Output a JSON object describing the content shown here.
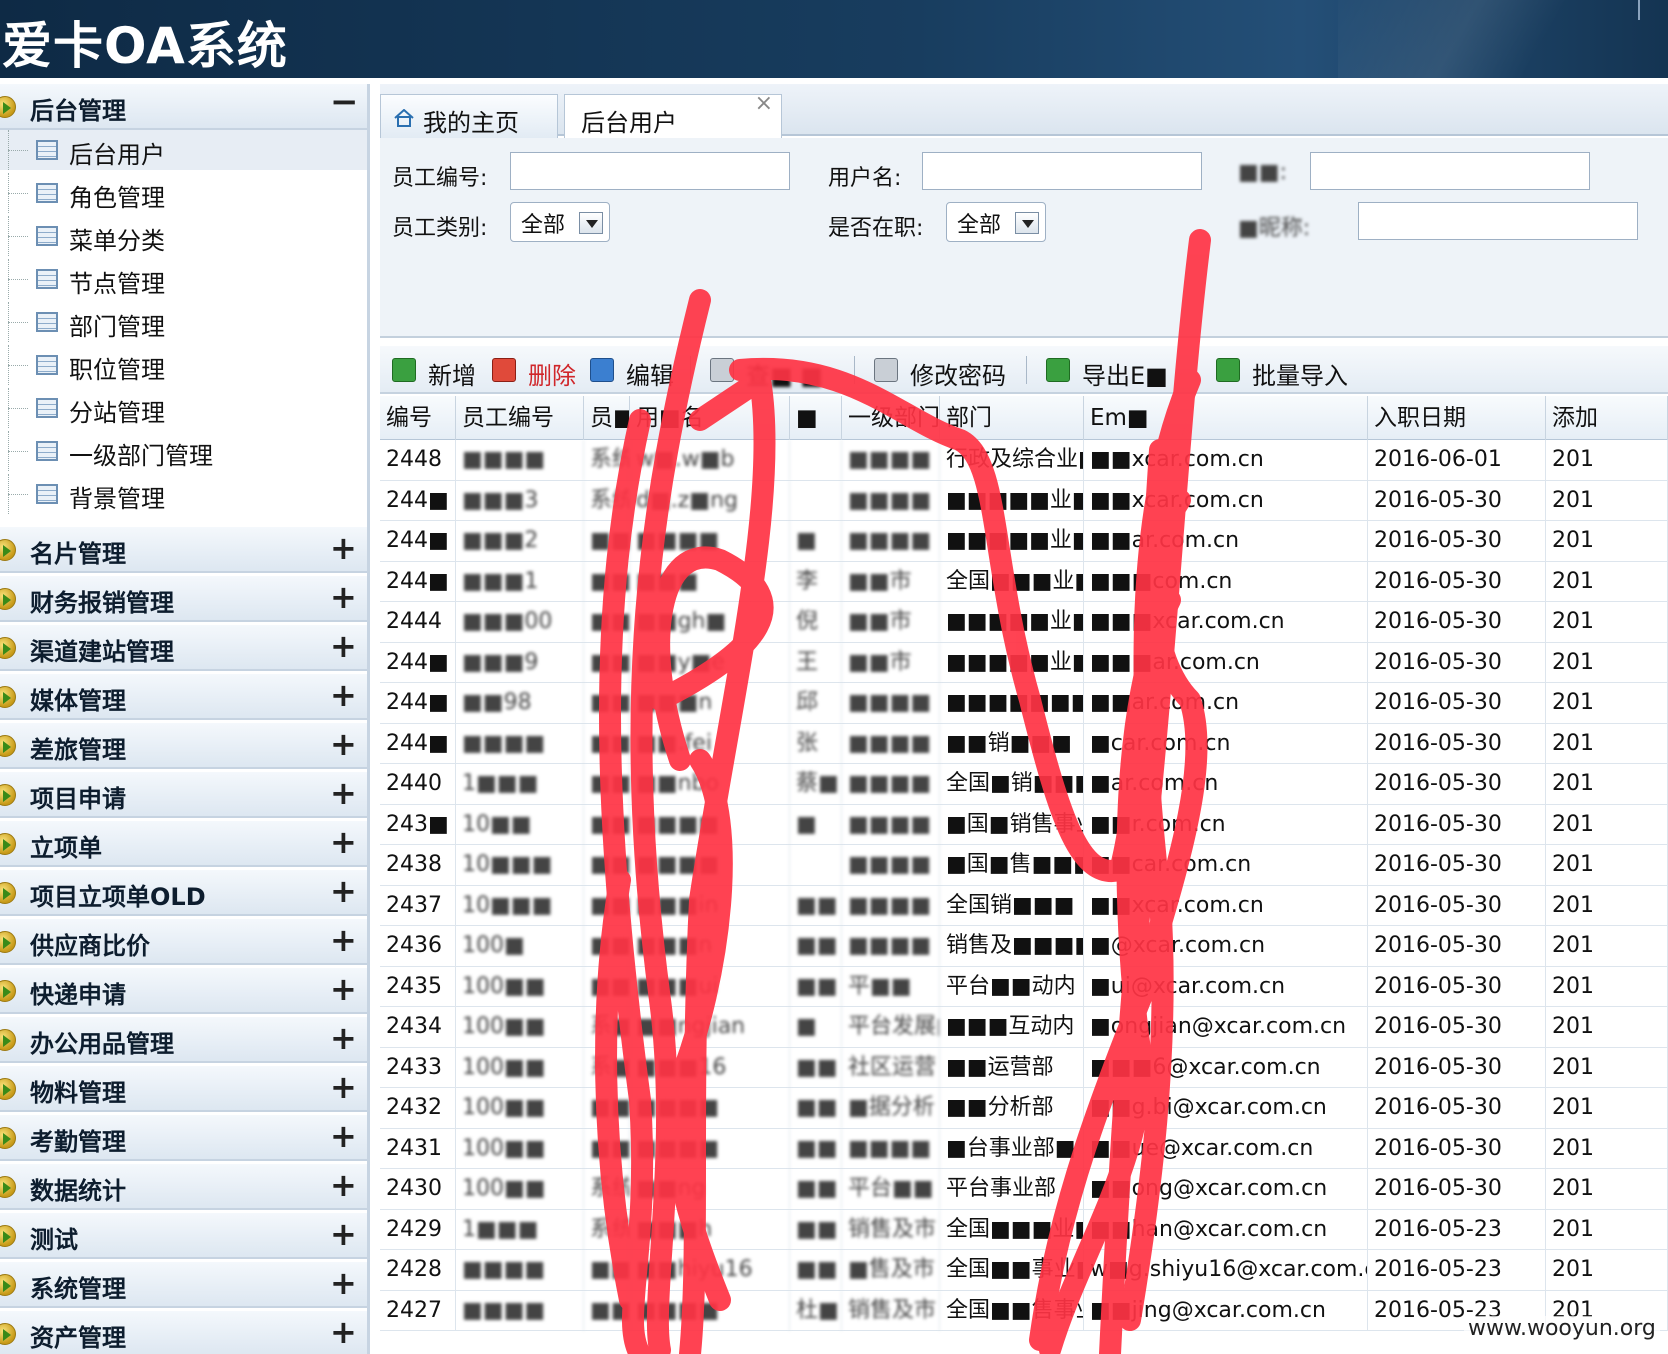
{
  "app": {
    "title": "爱卡OA系统"
  },
  "sidebar": {
    "expanded_group": {
      "label": "后台管理",
      "toggle": "−"
    },
    "sub_items": [
      {
        "label": "后台用户",
        "selected": true
      },
      {
        "label": "角色管理"
      },
      {
        "label": "菜单分类"
      },
      {
        "label": "节点管理"
      },
      {
        "label": "部门管理"
      },
      {
        "label": "职位管理"
      },
      {
        "label": "分站管理"
      },
      {
        "label": "一级部门管理"
      },
      {
        "label": "背景管理"
      }
    ],
    "groups": [
      {
        "label": "名片管理",
        "toggle": "+"
      },
      {
        "label": "财务报销管理",
        "toggle": "+"
      },
      {
        "label": "渠道建站管理",
        "toggle": "+"
      },
      {
        "label": "媒体管理",
        "toggle": "+"
      },
      {
        "label": "差旅管理",
        "toggle": "+"
      },
      {
        "label": "项目申请",
        "toggle": "+"
      },
      {
        "label": "立项单",
        "toggle": "+"
      },
      {
        "label": "项目立项单OLD",
        "toggle": "+"
      },
      {
        "label": "供应商比价",
        "toggle": "+"
      },
      {
        "label": "快递申请",
        "toggle": "+"
      },
      {
        "label": "办公用品管理",
        "toggle": "+"
      },
      {
        "label": "物料管理",
        "toggle": "+"
      },
      {
        "label": "考勤管理",
        "toggle": "+"
      },
      {
        "label": "数据统计",
        "toggle": "+"
      },
      {
        "label": "测试",
        "toggle": "+"
      },
      {
        "label": "系统管理",
        "toggle": "+"
      },
      {
        "label": "资产管理",
        "toggle": "+"
      }
    ]
  },
  "tabs": [
    {
      "label": "我的主页",
      "icon": "home-icon"
    },
    {
      "label": "后台用户",
      "close": "×",
      "active": true
    }
  ],
  "filters": {
    "emp_no_label": "员工编号:",
    "username_label": "用户名:",
    "third_label": "■■:",
    "emp_type_label": "员工类别:",
    "emp_type_value": "全部",
    "active_label": "是否在职:",
    "active_value": "全部",
    "nickname_label": "■昵称:"
  },
  "toolbar": {
    "add": "新增",
    "delete": "删除",
    "edit": "编辑",
    "view": "查■ ■",
    "change_pwd": "修改密码",
    "export": "导出E■",
    "import": "批量导入"
  },
  "grid": {
    "columns": [
      "编号",
      "员工编号",
      "员■",
      "用■名",
      "■",
      "一级部门",
      "部门",
      "Em■",
      "入职日期",
      "添加"
    ],
    "rows": [
      {
        "id": "2448",
        "emp_no": "■■■■",
        "name": "系统",
        "user": "w■.w■b",
        "c5": "",
        "dept1": "■■■■",
        "dept": "行政及综合业■",
        "email": "■■xcar.com.cn",
        "date": "2016-06-01",
        "added": "201"
      },
      {
        "id": "244■",
        "emp_no": "■■■3",
        "name": "系统",
        "user": "d■.z■ng",
        "c5": "",
        "dept1": "■■■■",
        "dept": "■■■■■业■",
        "email": "■■xcar.com.cn",
        "date": "2016-05-30",
        "added": "201"
      },
      {
        "id": "244■",
        "emp_no": "■■■2",
        "name": "■■",
        "user": "■■■■",
        "c5": "■",
        "dept1": "■■■■",
        "dept": "■■■■■业■",
        "email": "■■ar.com.cn",
        "date": "2016-05-30",
        "added": "201"
      },
      {
        "id": "244■",
        "emp_no": "■■■1",
        "name": "■■",
        "user": "■■■",
        "c5": "李",
        "dept1": "■■市",
        "dept": "全国■■■业■",
        "email": "■■■com.cn",
        "date": "2016-05-30",
        "added": "201"
      },
      {
        "id": "2444",
        "emp_no": "■■■00",
        "name": "■■",
        "user": "■■gh■",
        "c5": "倪",
        "dept1": "■■市",
        "dept": "■■■■■业■",
        "email": "■■■xcar.com.cn",
        "date": "2016-05-30",
        "added": "201"
      },
      {
        "id": "244■",
        "emp_no": "■■■9",
        "name": "■■",
        "user": "■■y■e",
        "c5": "王",
        "dept1": "■■市",
        "dept": "■■■■■业■",
        "email": "■■■ar.com.cn",
        "date": "2016-05-30",
        "added": "201"
      },
      {
        "id": "244■",
        "emp_no": "■■98",
        "name": "■■",
        "user": "■■■n",
        "c5": "邱",
        "dept1": "■■■■",
        "dept": "■■■■■■■",
        "email": "■■ar.com.cn",
        "date": "2016-05-30",
        "added": "201"
      },
      {
        "id": "244■",
        "emp_no": "■■■■",
        "name": "■■",
        "user": "■■.fei",
        "c5": "张",
        "dept1": "■■■■",
        "dept": "■■销■■■",
        "email": "■car.com.cn",
        "date": "2016-05-30",
        "added": "201"
      },
      {
        "id": "2440",
        "emp_no": "1■■■",
        "name": "■■",
        "user": "■■nbo",
        "c5": "蔡■",
        "dept1": "■■■■",
        "dept": "全国■销■■■",
        "email": "■ar.com.cn",
        "date": "2016-05-30",
        "added": "201"
      },
      {
        "id": "243■",
        "emp_no": "10■■",
        "name": "■■",
        "user": "■■■■",
        "c5": "■",
        "dept1": "■■■■",
        "dept": "■国■销售事业■",
        "email": "■■r.com.cn",
        "date": "2016-05-30",
        "added": "201"
      },
      {
        "id": "2438",
        "emp_no": "10■■■",
        "name": "■■",
        "user": "■■■■",
        "c5": "",
        "dept1": "■■■■",
        "dept": "■国■售■■■",
        "email": "■■car.com.cn",
        "date": "2016-05-30",
        "added": "201"
      },
      {
        "id": "2437",
        "emp_no": "10■■■",
        "name": "■■",
        "user": "■■■in",
        "c5": "■■",
        "dept1": "■■■■",
        "dept": "全国销■■■",
        "email": "■■xcar.com.cn",
        "date": "2016-05-30",
        "added": "201"
      },
      {
        "id": "2436",
        "emp_no": "100■",
        "name": "■■",
        "user": "■■■n",
        "c5": "■■",
        "dept1": "■■■■",
        "dept": "销售及■■■■",
        "email": "■@xcar.com.cn",
        "date": "2016-05-30",
        "added": "201"
      },
      {
        "id": "2435",
        "emp_no": "100■■",
        "name": "■■",
        "user": "■■■ui",
        "c5": "■■",
        "dept1": "平■■",
        "dept": "平台■■动内",
        "email": "■ui@xcar.com.cn",
        "date": "2016-05-30",
        "added": "201"
      },
      {
        "id": "2434",
        "emp_no": "100■■",
        "name": "系■",
        "user": "■■ngjian",
        "c5": "■",
        "dept1": "平台发展■",
        "dept": "■■■互动内",
        "email": "■ongjian@xcar.com.cn",
        "date": "2016-05-30",
        "added": "201"
      },
      {
        "id": "2433",
        "emp_no": "100■■",
        "name": "系■",
        "user": "■■■16",
        "c5": "■■",
        "dept1": "社区运营",
        "dept": "■■运营部",
        "email": "■■■6@xcar.com.cn",
        "date": "2016-05-30",
        "added": "201"
      },
      {
        "id": "2432",
        "emp_no": "100■■",
        "name": "■■",
        "user": "■■■■",
        "c5": "■■",
        "dept1": "■据分析",
        "dept": "■■分析部",
        "email": "■■g.bi@xcar.com.cn",
        "date": "2016-05-30",
        "added": "201"
      },
      {
        "id": "2431",
        "emp_no": "100■■",
        "name": "■■",
        "user": "■■■■",
        "c5": "■■",
        "dept1": "■■■■",
        "dept": "■台事业部■",
        "email": "■■ue@xcar.com.cn",
        "date": "2016-05-30",
        "added": "201"
      },
      {
        "id": "2430",
        "emp_no": "100■■",
        "name": "系统",
        "user": "■■ng",
        "c5": "■■",
        "dept1": "平台■■",
        "dept": "平台事业部",
        "email": "■■ong@xcar.com.cn",
        "date": "2016-05-30",
        "added": "201"
      },
      {
        "id": "2429",
        "emp_no": "1■■■",
        "name": "系统",
        "user": "■■■h",
        "c5": "■■",
        "dept1": "销售及市",
        "dept": "全国■■■业■",
        "email": "■■han@xcar.com.cn",
        "date": "2016-05-23",
        "added": "201"
      },
      {
        "id": "2428",
        "emp_no": "■■■■",
        "name": "■■",
        "user": "■■hiyu16",
        "c5": "■■",
        "dept1": "■售及市",
        "dept": "全国■■事业■",
        "email": "w■g.shiyu16@xcar.com.cn",
        "date": "2016-05-23",
        "added": "201"
      },
      {
        "id": "2427",
        "emp_no": "■■■■",
        "name": "■■",
        "user": "■■■■",
        "c5": "杜■",
        "dept1": "销售及市",
        "dept": "全国■■售事业■",
        "email": "■■jing@xcar.com.cn",
        "date": "2016-05-23",
        "added": "201"
      }
    ]
  },
  "watermark": "www.wooyun.org",
  "colors": {
    "header_bg": "#183d5f",
    "panel_bg": "#eef3f8",
    "scribble": "#ff3344"
  }
}
